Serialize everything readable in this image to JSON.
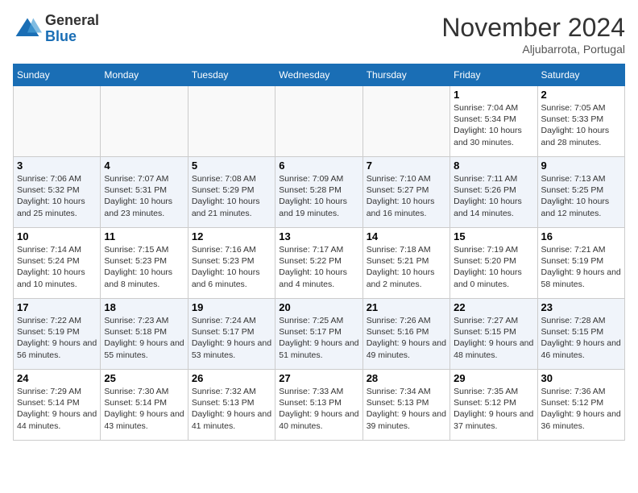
{
  "header": {
    "logo_general": "General",
    "logo_blue": "Blue",
    "month": "November 2024",
    "location": "Aljubarrota, Portugal"
  },
  "weekdays": [
    "Sunday",
    "Monday",
    "Tuesday",
    "Wednesday",
    "Thursday",
    "Friday",
    "Saturday"
  ],
  "weeks": [
    [
      {
        "day": "",
        "info": ""
      },
      {
        "day": "",
        "info": ""
      },
      {
        "day": "",
        "info": ""
      },
      {
        "day": "",
        "info": ""
      },
      {
        "day": "",
        "info": ""
      },
      {
        "day": "1",
        "info": "Sunrise: 7:04 AM\nSunset: 5:34 PM\nDaylight: 10 hours and 30 minutes."
      },
      {
        "day": "2",
        "info": "Sunrise: 7:05 AM\nSunset: 5:33 PM\nDaylight: 10 hours and 28 minutes."
      }
    ],
    [
      {
        "day": "3",
        "info": "Sunrise: 7:06 AM\nSunset: 5:32 PM\nDaylight: 10 hours and 25 minutes."
      },
      {
        "day": "4",
        "info": "Sunrise: 7:07 AM\nSunset: 5:31 PM\nDaylight: 10 hours and 23 minutes."
      },
      {
        "day": "5",
        "info": "Sunrise: 7:08 AM\nSunset: 5:29 PM\nDaylight: 10 hours and 21 minutes."
      },
      {
        "day": "6",
        "info": "Sunrise: 7:09 AM\nSunset: 5:28 PM\nDaylight: 10 hours and 19 minutes."
      },
      {
        "day": "7",
        "info": "Sunrise: 7:10 AM\nSunset: 5:27 PM\nDaylight: 10 hours and 16 minutes."
      },
      {
        "day": "8",
        "info": "Sunrise: 7:11 AM\nSunset: 5:26 PM\nDaylight: 10 hours and 14 minutes."
      },
      {
        "day": "9",
        "info": "Sunrise: 7:13 AM\nSunset: 5:25 PM\nDaylight: 10 hours and 12 minutes."
      }
    ],
    [
      {
        "day": "10",
        "info": "Sunrise: 7:14 AM\nSunset: 5:24 PM\nDaylight: 10 hours and 10 minutes."
      },
      {
        "day": "11",
        "info": "Sunrise: 7:15 AM\nSunset: 5:23 PM\nDaylight: 10 hours and 8 minutes."
      },
      {
        "day": "12",
        "info": "Sunrise: 7:16 AM\nSunset: 5:23 PM\nDaylight: 10 hours and 6 minutes."
      },
      {
        "day": "13",
        "info": "Sunrise: 7:17 AM\nSunset: 5:22 PM\nDaylight: 10 hours and 4 minutes."
      },
      {
        "day": "14",
        "info": "Sunrise: 7:18 AM\nSunset: 5:21 PM\nDaylight: 10 hours and 2 minutes."
      },
      {
        "day": "15",
        "info": "Sunrise: 7:19 AM\nSunset: 5:20 PM\nDaylight: 10 hours and 0 minutes."
      },
      {
        "day": "16",
        "info": "Sunrise: 7:21 AM\nSunset: 5:19 PM\nDaylight: 9 hours and 58 minutes."
      }
    ],
    [
      {
        "day": "17",
        "info": "Sunrise: 7:22 AM\nSunset: 5:19 PM\nDaylight: 9 hours and 56 minutes."
      },
      {
        "day": "18",
        "info": "Sunrise: 7:23 AM\nSunset: 5:18 PM\nDaylight: 9 hours and 55 minutes."
      },
      {
        "day": "19",
        "info": "Sunrise: 7:24 AM\nSunset: 5:17 PM\nDaylight: 9 hours and 53 minutes."
      },
      {
        "day": "20",
        "info": "Sunrise: 7:25 AM\nSunset: 5:17 PM\nDaylight: 9 hours and 51 minutes."
      },
      {
        "day": "21",
        "info": "Sunrise: 7:26 AM\nSunset: 5:16 PM\nDaylight: 9 hours and 49 minutes."
      },
      {
        "day": "22",
        "info": "Sunrise: 7:27 AM\nSunset: 5:15 PM\nDaylight: 9 hours and 48 minutes."
      },
      {
        "day": "23",
        "info": "Sunrise: 7:28 AM\nSunset: 5:15 PM\nDaylight: 9 hours and 46 minutes."
      }
    ],
    [
      {
        "day": "24",
        "info": "Sunrise: 7:29 AM\nSunset: 5:14 PM\nDaylight: 9 hours and 44 minutes."
      },
      {
        "day": "25",
        "info": "Sunrise: 7:30 AM\nSunset: 5:14 PM\nDaylight: 9 hours and 43 minutes."
      },
      {
        "day": "26",
        "info": "Sunrise: 7:32 AM\nSunset: 5:13 PM\nDaylight: 9 hours and 41 minutes."
      },
      {
        "day": "27",
        "info": "Sunrise: 7:33 AM\nSunset: 5:13 PM\nDaylight: 9 hours and 40 minutes."
      },
      {
        "day": "28",
        "info": "Sunrise: 7:34 AM\nSunset: 5:13 PM\nDaylight: 9 hours and 39 minutes."
      },
      {
        "day": "29",
        "info": "Sunrise: 7:35 AM\nSunset: 5:12 PM\nDaylight: 9 hours and 37 minutes."
      },
      {
        "day": "30",
        "info": "Sunrise: 7:36 AM\nSunset: 5:12 PM\nDaylight: 9 hours and 36 minutes."
      }
    ]
  ]
}
